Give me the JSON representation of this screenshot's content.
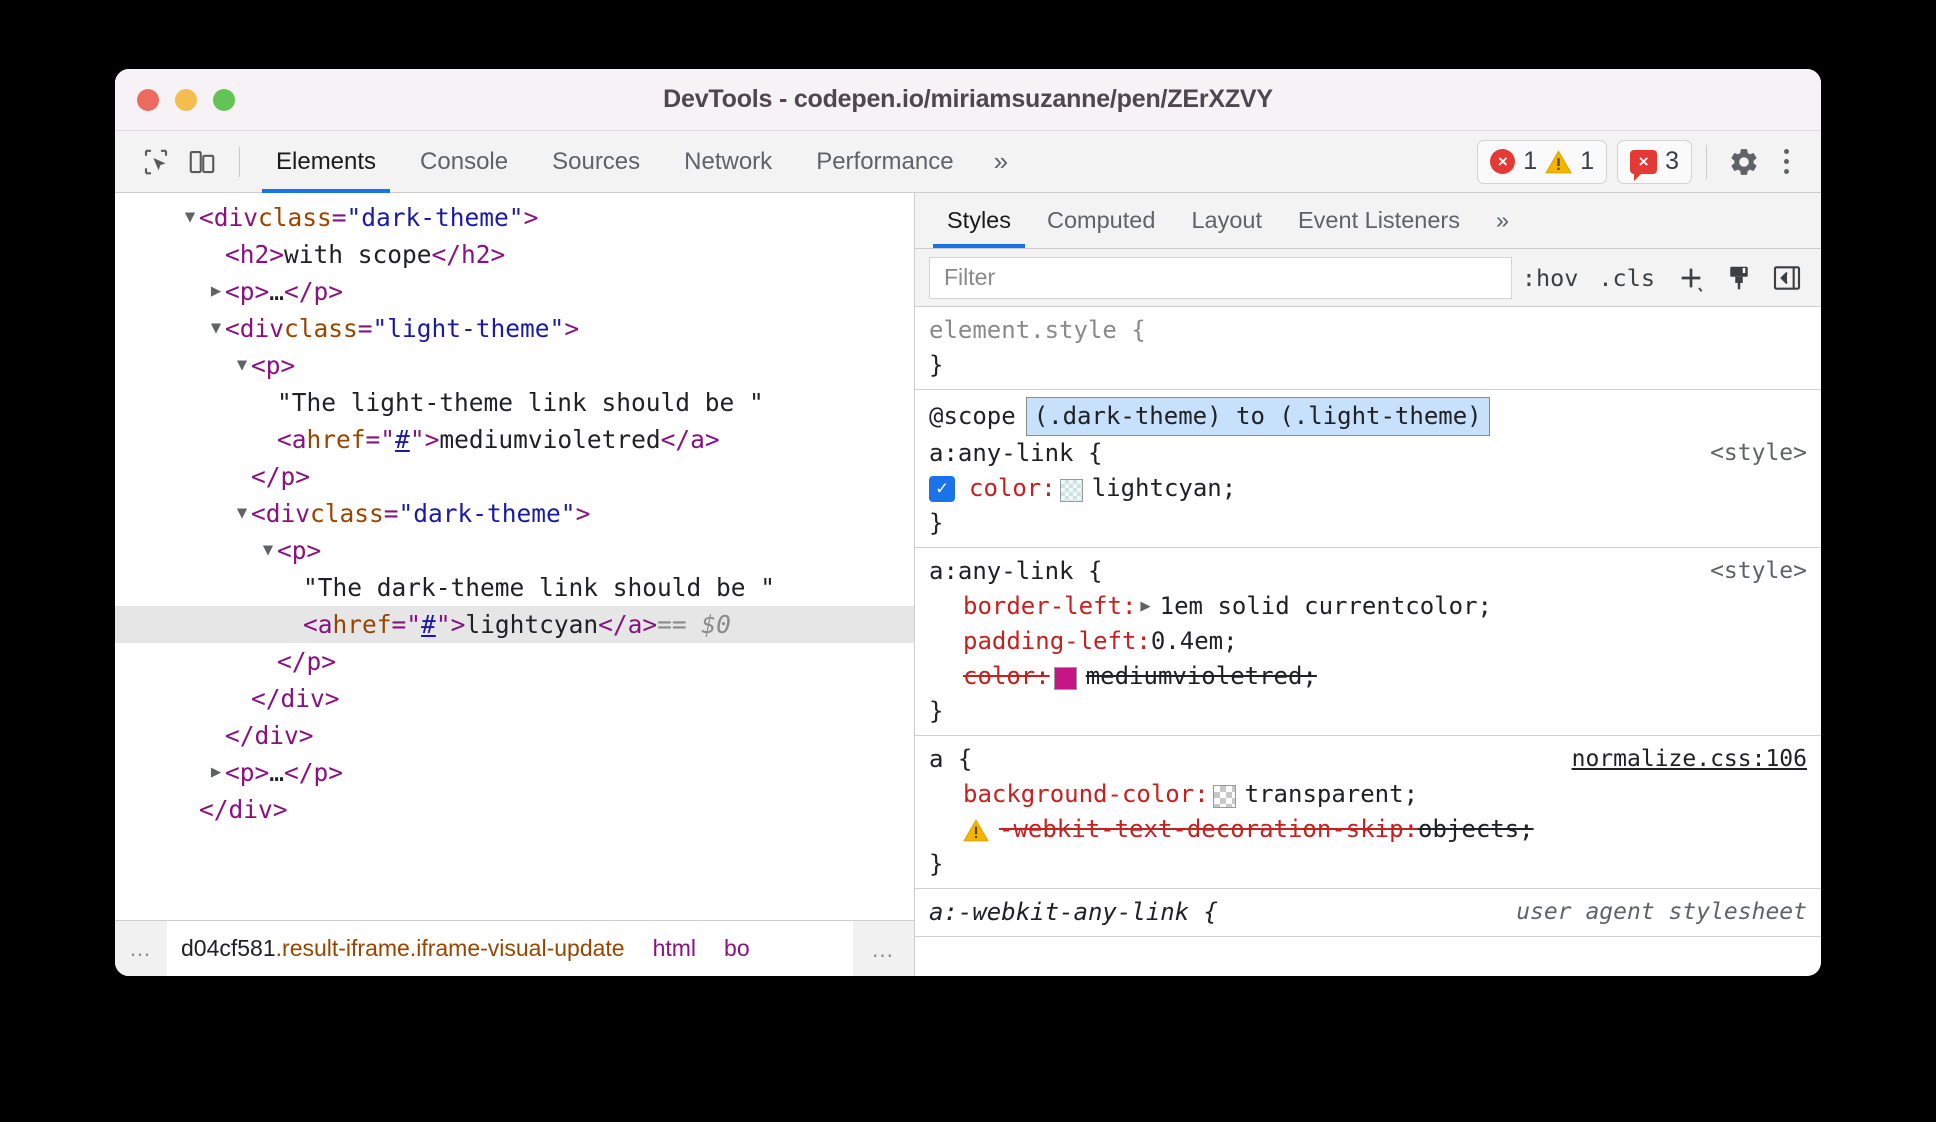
{
  "window": {
    "title": "DevTools - codepen.io/miriamsuzanne/pen/ZErXZVY",
    "traffic": {
      "close": "close",
      "minimize": "minimize",
      "zoom": "zoom"
    }
  },
  "toolbar": {
    "inspect_icon": "inspect-element-icon",
    "device_icon": "device-toolbar-icon",
    "tabs": [
      {
        "label": "Elements",
        "active": true
      },
      {
        "label": "Console",
        "active": false
      },
      {
        "label": "Sources",
        "active": false
      },
      {
        "label": "Network",
        "active": false
      },
      {
        "label": "Performance",
        "active": false
      }
    ],
    "more_tabs": "»",
    "errors_count": "1",
    "warnings_count": "1",
    "issues_count": "3",
    "settings_icon": "gear-icon",
    "menu_icon": "kebab-menu-icon"
  },
  "dom_tree": {
    "rows": [
      {
        "indent": 0,
        "marker": "down",
        "parts": [
          {
            "t": "tag",
            "v": "<div "
          },
          {
            "t": "attrname",
            "v": "class"
          },
          {
            "t": "tag",
            "v": "="
          },
          {
            "t": "attrval",
            "v": "\"dark-theme\""
          },
          {
            "t": "tag",
            "v": ">"
          }
        ]
      },
      {
        "indent": 1,
        "marker": "none",
        "parts": [
          {
            "t": "tag",
            "v": "<h2>"
          },
          {
            "t": "txt",
            "v": "with scope"
          },
          {
            "t": "tag",
            "v": "</h2>"
          }
        ]
      },
      {
        "indent": 1,
        "marker": "right",
        "parts": [
          {
            "t": "tag",
            "v": "<p>"
          },
          {
            "t": "txt",
            "v": "…"
          },
          {
            "t": "tag",
            "v": "</p>"
          }
        ]
      },
      {
        "indent": 1,
        "marker": "down",
        "parts": [
          {
            "t": "tag",
            "v": "<div "
          },
          {
            "t": "attrname",
            "v": "class"
          },
          {
            "t": "tag",
            "v": "="
          },
          {
            "t": "attrval",
            "v": "\"light-theme\""
          },
          {
            "t": "tag",
            "v": ">"
          }
        ]
      },
      {
        "indent": 2,
        "marker": "down",
        "parts": [
          {
            "t": "tag",
            "v": "<p>"
          }
        ]
      },
      {
        "indent": 3,
        "marker": "none",
        "parts": [
          {
            "t": "txt",
            "v": "\"The light-theme link should be \""
          }
        ]
      },
      {
        "indent": 3,
        "marker": "none",
        "parts": [
          {
            "t": "tag",
            "v": "<a "
          },
          {
            "t": "attrname",
            "v": "href"
          },
          {
            "t": "tag",
            "v": "=\""
          },
          {
            "t": "hashlink",
            "v": "#"
          },
          {
            "t": "tag",
            "v": "\">"
          },
          {
            "t": "txt",
            "v": "mediumvioletred"
          },
          {
            "t": "tag",
            "v": "</a>"
          }
        ]
      },
      {
        "indent": 2,
        "marker": "none",
        "parts": [
          {
            "t": "tag",
            "v": "</p>"
          }
        ]
      },
      {
        "indent": 2,
        "marker": "down",
        "parts": [
          {
            "t": "tag",
            "v": "<div "
          },
          {
            "t": "attrname",
            "v": "class"
          },
          {
            "t": "tag",
            "v": "="
          },
          {
            "t": "attrval",
            "v": "\"dark-theme\""
          },
          {
            "t": "tag",
            "v": ">"
          }
        ]
      },
      {
        "indent": 3,
        "marker": "down",
        "parts": [
          {
            "t": "tag",
            "v": "<p>"
          }
        ]
      },
      {
        "indent": 4,
        "marker": "none",
        "parts": [
          {
            "t": "txt",
            "v": "\"The dark-theme link should be \""
          }
        ]
      },
      {
        "indent": 4,
        "marker": "none",
        "selected": true,
        "parts": [
          {
            "t": "tag",
            "v": "<a "
          },
          {
            "t": "attrname",
            "v": "href"
          },
          {
            "t": "tag",
            "v": "=\""
          },
          {
            "t": "hashlink",
            "v": "#"
          },
          {
            "t": "tag",
            "v": "\">"
          },
          {
            "t": "txt",
            "v": "lightcyan"
          },
          {
            "t": "tag",
            "v": "</a>"
          },
          {
            "t": "dollar",
            "v": "  == $0"
          }
        ]
      },
      {
        "indent": 3,
        "marker": "none",
        "parts": [
          {
            "t": "tag",
            "v": "</p>"
          }
        ]
      },
      {
        "indent": 2,
        "marker": "none",
        "parts": [
          {
            "t": "tag",
            "v": "</div>"
          }
        ]
      },
      {
        "indent": 1,
        "marker": "none",
        "parts": [
          {
            "t": "tag",
            "v": "</div>"
          }
        ]
      },
      {
        "indent": 1,
        "marker": "right",
        "parts": [
          {
            "t": "tag",
            "v": "<p>"
          },
          {
            "t": "txt",
            "v": "…"
          },
          {
            "t": "tag",
            "v": "</p>"
          }
        ]
      },
      {
        "indent": 0,
        "marker": "none",
        "parts": [
          {
            "t": "tag",
            "v": "</div>"
          }
        ]
      }
    ]
  },
  "breadcrumb": {
    "overflow_left": "…",
    "items": [
      {
        "id": "d04cf581",
        "classes": ".result-iframe.iframe-visual-update",
        "tag": ""
      },
      {
        "id": "",
        "classes": "",
        "tag": "html"
      },
      {
        "id": "",
        "classes": "",
        "tag": "bo"
      }
    ],
    "overflow_right": "…"
  },
  "styles": {
    "tabs": [
      {
        "label": "Styles",
        "active": true
      },
      {
        "label": "Computed",
        "active": false
      },
      {
        "label": "Layout",
        "active": false
      },
      {
        "label": "Event Listeners",
        "active": false
      }
    ],
    "more_tabs": "»",
    "filter_placeholder": "Filter",
    "filter_value": "",
    "hov_label": ":hov",
    "cls_label": ".cls",
    "new_rule_label": "+",
    "color_picker_icon": "paintbrush-icon",
    "sidebar_toggle_icon": "sidebar-toggle-icon",
    "rules": [
      {
        "selector": "element.style {",
        "selector_style": "grey",
        "origin": "",
        "scope": null,
        "declarations": [],
        "close": "}"
      },
      {
        "scope_keyword": "@scope",
        "scope_prelude": "(.dark-theme) to (.light-theme)",
        "selector": "a:any-link {",
        "selector_style": "normal",
        "origin": "<style>",
        "origin_style": "plain",
        "declarations": [
          {
            "checkbox": true,
            "name": "color",
            "colon": ":",
            "swatch": "lightcyan",
            "value": "lightcyan;",
            "struck": false
          }
        ],
        "close": "}"
      },
      {
        "selector": "a:any-link {",
        "selector_style": "normal",
        "origin": "<style>",
        "origin_style": "plain",
        "declarations": [
          {
            "checkbox": false,
            "expander": true,
            "name": "border-left",
            "colon": ":",
            "value": "1em solid currentcolor;",
            "struck": false
          },
          {
            "checkbox": false,
            "name": "padding-left",
            "colon": ":",
            "value": "0.4em;",
            "struck": false
          },
          {
            "checkbox": false,
            "name": "color",
            "colon": ":",
            "swatch": "mediumvioletred",
            "value": "mediumvioletred;",
            "struck": true
          }
        ],
        "close": "}"
      },
      {
        "selector": "a {",
        "selector_style": "normal",
        "origin": "normalize.css:106",
        "origin_style": "link",
        "declarations": [
          {
            "checkbox": false,
            "name": "background-color",
            "colon": ":",
            "swatch": "transparent",
            "value": "transparent;",
            "struck": false
          },
          {
            "warning": true,
            "name": "-webkit-text-decoration-skip",
            "colon": ":",
            "value": "objects;",
            "struck": true
          }
        ],
        "close": "}"
      },
      {
        "selector": "a:-webkit-any-link {",
        "selector_style": "ua",
        "origin": "user agent stylesheet",
        "origin_style": "italic",
        "declarations": [],
        "close": ""
      }
    ]
  },
  "colors": {
    "accent": "#1a73e8",
    "error": "#e53935",
    "warning": "#f4b400",
    "prop": "#c5221f",
    "tag": "#881280",
    "attr_name": "#994500",
    "attr_value": "#1a1aa6",
    "selection": "#c7e0fb"
  }
}
